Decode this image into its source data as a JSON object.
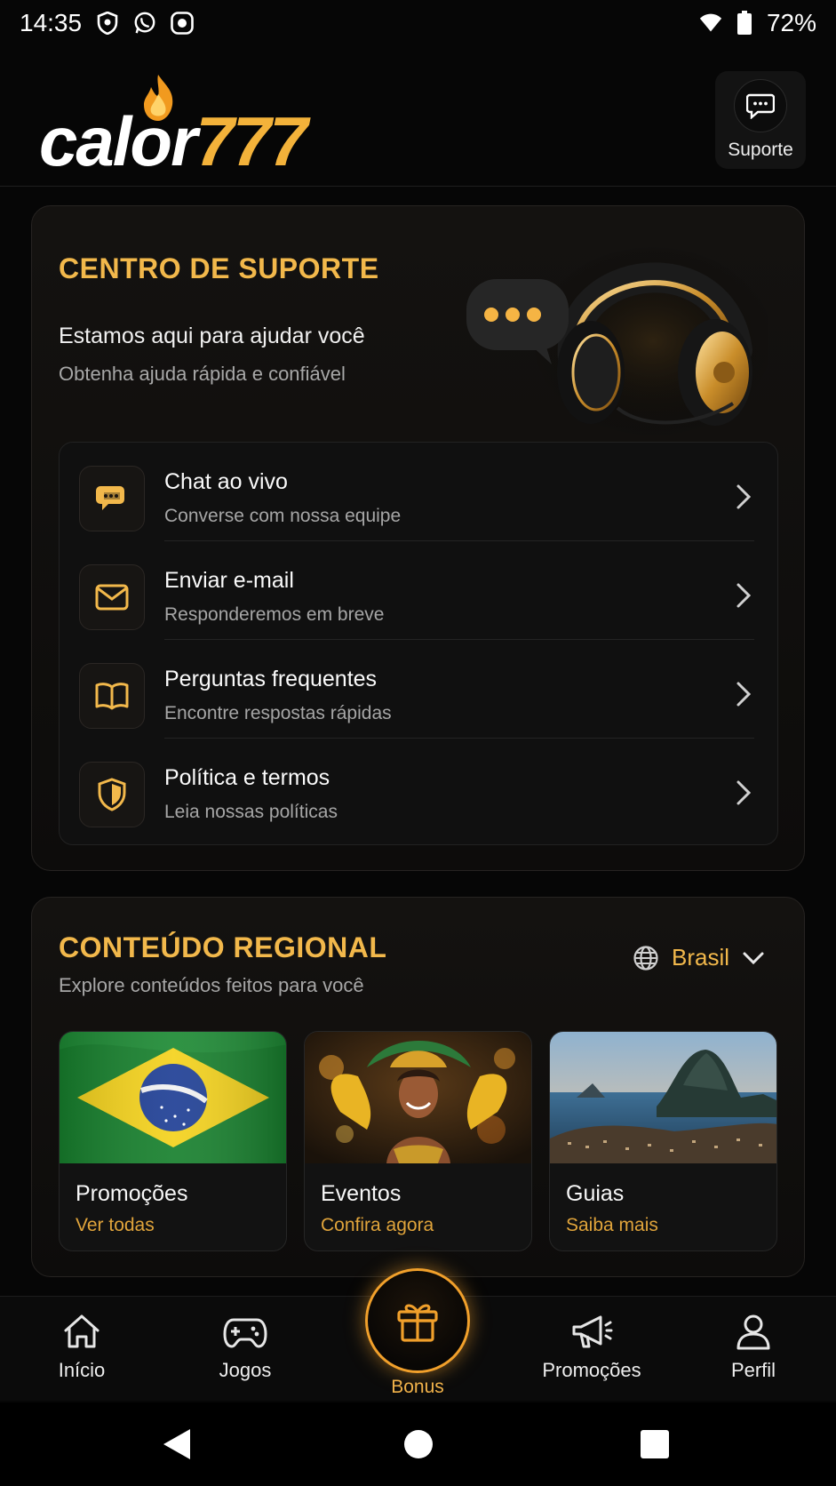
{
  "status": {
    "time": "14:35",
    "battery": "72%"
  },
  "header": {
    "logo_text": "calor",
    "logo_number": "777",
    "support_label": "Suporte"
  },
  "support_center": {
    "title": "CENTRO DE SUPORTE",
    "subtitle": "Estamos aqui para ajudar você",
    "description": "Obtenha ajuda rápida e confiável",
    "items": [
      {
        "title": "Chat ao vivo",
        "subtitle": "Converse com nossa equipe",
        "icon": "chat-bubble-icon"
      },
      {
        "title": "Enviar e-mail",
        "subtitle": "Responderemos em breve",
        "icon": "mail-icon"
      },
      {
        "title": "Perguntas frequentes",
        "subtitle": "Encontre respostas rápidas",
        "icon": "book-icon"
      },
      {
        "title": "Política e termos",
        "subtitle": "Leia nossas políticas",
        "icon": "shield-icon"
      }
    ]
  },
  "regional": {
    "title": "CONTEÚDO REGIONAL",
    "subtitle": "Explore conteúdos feitos para você",
    "region": "Brasil",
    "tiles": [
      {
        "title": "Promoções",
        "link": "Ver todas",
        "image": "brazil-flag"
      },
      {
        "title": "Eventos",
        "link": "Confira agora",
        "image": "carnival-dancer"
      },
      {
        "title": "Guias",
        "link": "Saiba mais",
        "image": "rio-sugarloaf"
      }
    ]
  },
  "bottom_nav": {
    "home": "Início",
    "games": "Jogos",
    "bonus": "Bonus",
    "promotions": "Promoções",
    "profile": "Perfil"
  },
  "colors": {
    "accent": "#f2b84b",
    "bonus_ring": "#f1a02b",
    "background": "#060606"
  }
}
